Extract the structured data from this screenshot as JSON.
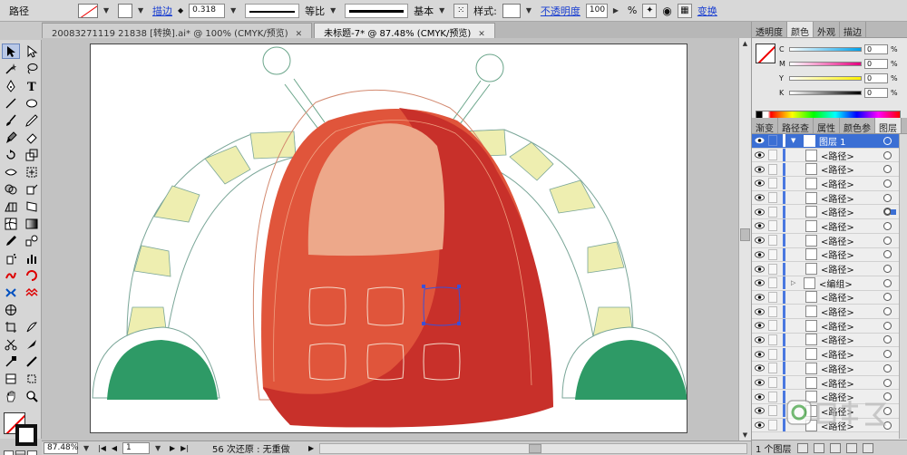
{
  "control_bar": {
    "object_type": "路径",
    "stroke_link": "描边",
    "stroke_weight": "0.318",
    "profile_label": "等比",
    "brush_label": "基本",
    "style_label": "样式:",
    "opacity_link": "不透明度",
    "opacity_value": "100",
    "opacity_unit": "%",
    "transform_link": "变换"
  },
  "tabs": [
    {
      "label": "20083271119 21838 [转换].ai* @ 100% (CMYK/预览)"
    },
    {
      "label": "未标题-7* @ 87.48% (CMYK/预览)"
    }
  ],
  "status": {
    "zoom": "87.48%",
    "page": "1",
    "history": "56 次还原 : 无重做"
  },
  "color_panel": {
    "tabs": [
      "透明度",
      "颜色",
      "外观",
      "描边"
    ],
    "channels": [
      {
        "label": "C",
        "value": "0",
        "color": "#00a0e9"
      },
      {
        "label": "M",
        "value": "0",
        "color": "#e4007f"
      },
      {
        "label": "Y",
        "value": "0",
        "color": "#fff100"
      },
      {
        "label": "K",
        "value": "0",
        "color": "#000000"
      }
    ],
    "percent": "%"
  },
  "layers_panel": {
    "tabs": [
      "渐变",
      "路径查",
      "属性",
      "颜色参",
      "图层"
    ],
    "layer_name": "图层 1",
    "items": [
      "<路径>",
      "<路径>",
      "<路径>",
      "<路径>",
      "<路径>",
      "<路径>",
      "<路径>",
      "<路径>",
      "<路径>",
      "<编组>",
      "<路径>",
      "<路径>",
      "<路径>",
      "<路径>",
      "<路径>",
      "<路径>",
      "<路径>",
      "<路径>",
      "<路径>",
      "<路径>"
    ],
    "footer_count": "1 个图层"
  },
  "colors": {
    "accent": "#3b6fd4",
    "body_red": "#e0553b",
    "body_dark": "#c8302a",
    "window": "#eda88a",
    "arm_yellow": "#eeeeb0",
    "foot_green": "#2e9a66"
  }
}
